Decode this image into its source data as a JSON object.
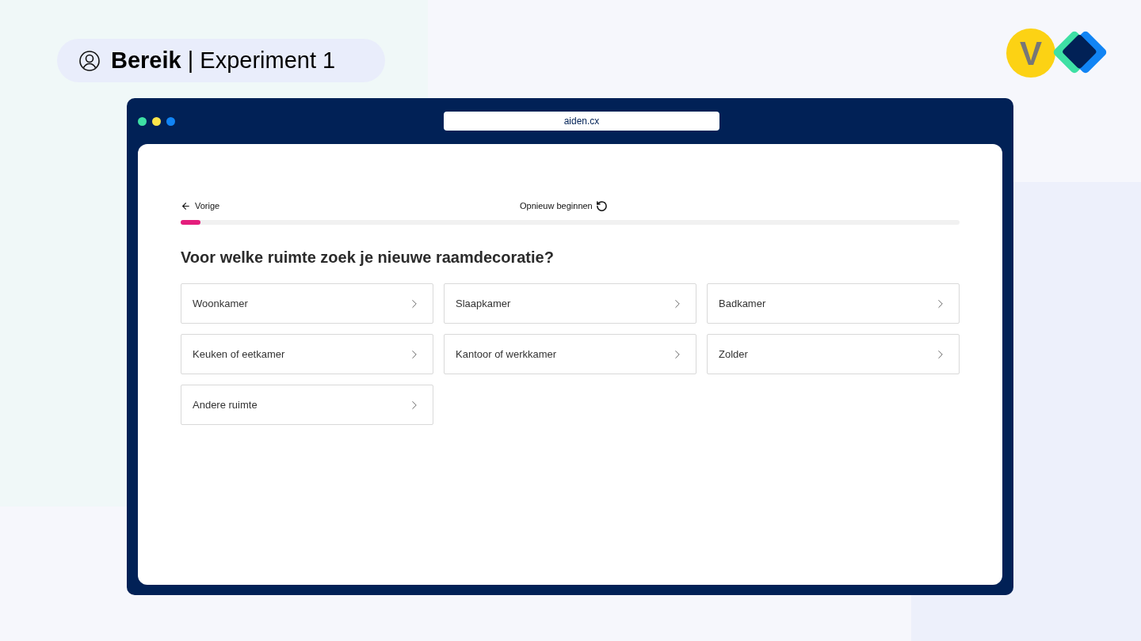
{
  "header": {
    "title_bold": "Bereik",
    "separator": "|",
    "title_rest": "Experiment 1"
  },
  "logo": {
    "letter": "V"
  },
  "browser": {
    "url": "aiden.cx"
  },
  "nav": {
    "back": "Vorige",
    "restart": "Opnieuw beginnen"
  },
  "progress": {
    "level": 0.025
  },
  "question": "Voor welke ruimte zoek je nieuwe raamdecoratie?",
  "options": [
    {
      "label": "Woonkamer"
    },
    {
      "label": "Slaapkamer"
    },
    {
      "label": "Badkamer"
    },
    {
      "label": "Keuken of eetkamer"
    },
    {
      "label": "Kantoor of werkkamer"
    },
    {
      "label": "Zolder"
    },
    {
      "label": "Andere ruimte"
    }
  ]
}
